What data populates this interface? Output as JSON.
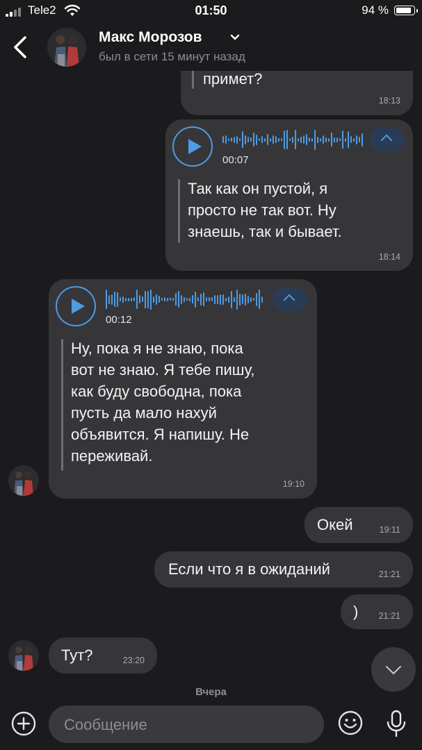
{
  "status_bar": {
    "carrier": "Tele2",
    "time": "01:50",
    "battery": "94 %",
    "battery_level": 0.94
  },
  "header": {
    "name": "Макс Морозов",
    "last_seen": "был в сети 15 минут назад"
  },
  "messages": {
    "m0": {
      "text": "примет?",
      "time": "18:13"
    },
    "m1": {
      "duration": "00:07",
      "transcript": "Так как он пустой, я\nпросто не так вот. Ну\nзнаешь, так и бывает.",
      "time": "18:14"
    },
    "m2": {
      "duration": "00:12",
      "transcript": "Ну, пока я не знаю, пока\nвот не знаю. Я тебе пишу,\nкак буду свободна, пока\nпусть да мало нахуй\nобъявится. Я напишу. Не\nпереживай.",
      "time": "19:10"
    },
    "m3": {
      "text": "Окей",
      "time": "19:11"
    },
    "m4": {
      "text": "Если что я в ожиданий",
      "time": "21:21"
    },
    "m5": {
      "text": ")",
      "time": "21:21"
    },
    "m6": {
      "text": "Тут?",
      "time": "23:20"
    }
  },
  "date_separator": "Вчера",
  "composer": {
    "placeholder": "Сообщение"
  },
  "colors": {
    "accent": "#4f9be5",
    "bubble": "#363638",
    "background": "#1b1b1d"
  }
}
